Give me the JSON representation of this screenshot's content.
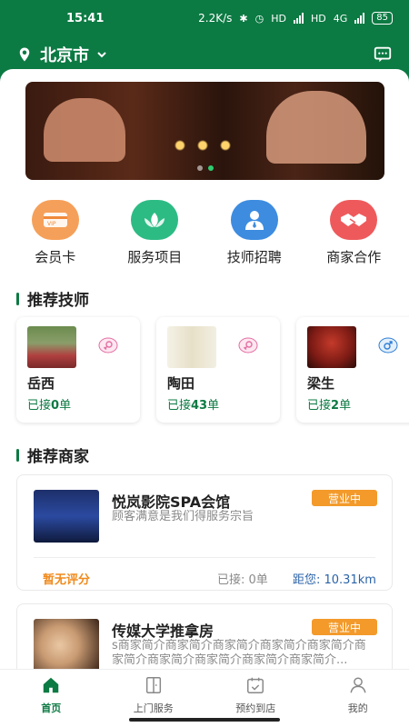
{
  "status_bar": {
    "time": "15:41",
    "network_speed": "2.2K/s",
    "bluetooth_icon": "bluetooth-icon",
    "alarm_icon": "alarm-icon",
    "hd_label_1": "HD",
    "hd_label_2": "HD",
    "signal_label": "4G",
    "battery": "85"
  },
  "header": {
    "city": "北京市",
    "location_icon": "map-pin-icon",
    "dropdown_icon": "chevron-down-icon",
    "message_icon": "message-icon"
  },
  "banner": {
    "slides": 2,
    "active_slide": 1
  },
  "menu": {
    "items": [
      {
        "label": "会员卡",
        "icon": "card-icon",
        "color": "#f08a3a"
      },
      {
        "label": "服务项目",
        "icon": "lotus-icon",
        "color": "#21b07a"
      },
      {
        "label": "技师招聘",
        "icon": "staff-icon",
        "color": "#2f7fd6"
      },
      {
        "label": "商家合作",
        "icon": "handshake-icon",
        "color": "#e6484b"
      }
    ]
  },
  "technicians": {
    "title": "推荐技师",
    "items": [
      {
        "name": "岳西",
        "prefix": "已接",
        "count": "0",
        "suffix": "单",
        "gender": "female"
      },
      {
        "name": "陶田",
        "prefix": "已接",
        "count": "43",
        "suffix": "单",
        "gender": "female"
      },
      {
        "name": "梁生",
        "prefix": "已接",
        "count": "2",
        "suffix": "单",
        "gender": "male"
      }
    ]
  },
  "merchants": {
    "title": "推荐商家",
    "items": [
      {
        "name": "悦岚影院SPA会馆",
        "desc": "顾客满意是我们得服务宗旨",
        "badge": "营业中",
        "rating": "暂无评分",
        "received": "已接: 0单",
        "distance": "距您: 10.31km"
      },
      {
        "name": "传媒大学推拿房",
        "desc": "s商家简介商家简介商家简介商家简介商家简介商家简介商家简介商家简介商家简介商家简介...",
        "badge": "营业中"
      }
    ]
  },
  "tabbar": {
    "items": [
      {
        "label": "首页",
        "icon": "home-icon",
        "active": true
      },
      {
        "label": "上门服务",
        "icon": "door-icon",
        "active": false
      },
      {
        "label": "预约到店",
        "icon": "calendar-check-icon",
        "active": false
      },
      {
        "label": "我的",
        "icon": "user-icon",
        "active": false
      }
    ]
  },
  "colors": {
    "brand": "#0c7a43",
    "badge": "#f39a2b",
    "rating": "#f08a1c",
    "distance": "#2b63a8"
  }
}
